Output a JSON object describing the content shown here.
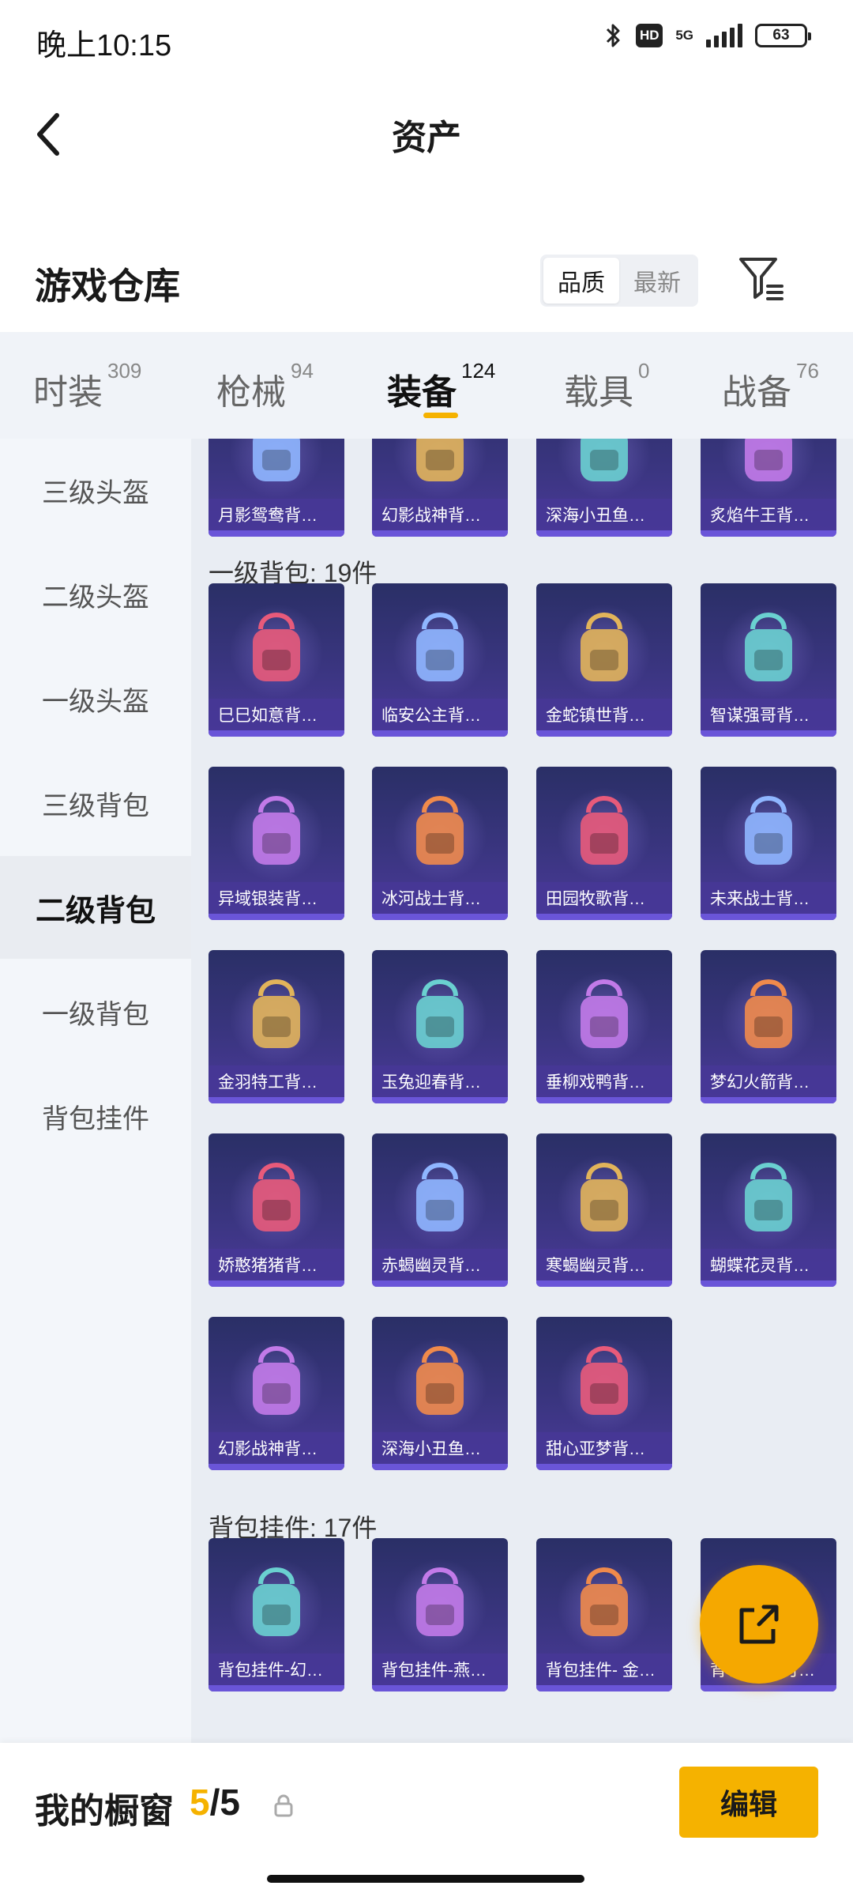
{
  "status": {
    "time": "晚上10:15",
    "hd": "HD",
    "net": "5G",
    "battery": "63"
  },
  "header": {
    "title": "资产"
  },
  "warehouse": {
    "title": "游戏仓库",
    "sort_options": [
      "品质",
      "最新"
    ],
    "sort_selected": "品质"
  },
  "tabs": [
    {
      "label": "时装",
      "count": "309"
    },
    {
      "label": "枪械",
      "count": "94"
    },
    {
      "label": "装备",
      "count": "124"
    },
    {
      "label": "载具",
      "count": "0"
    },
    {
      "label": "战备",
      "count": "76"
    }
  ],
  "active_tab": "装备",
  "sidenav": [
    "三级头盔",
    "二级头盔",
    "一级头盔",
    "三级背包",
    "二级背包",
    "一级背包",
    "背包挂件"
  ],
  "active_side": "二级背包",
  "top_row": [
    "月影鸳鸯背…",
    "幻影战神背…",
    "深海小丑鱼…",
    "炙焰牛王背…"
  ],
  "sections": [
    {
      "title": "一级背包: 19件",
      "items": [
        "巳巳如意背…",
        "临安公主背…",
        "金蛇镇世背…",
        "智谋强哥背…",
        "异域银装背…",
        "冰河战士背…",
        "田园牧歌背…",
        "未来战士背…",
        "金羽特工背…",
        "玉兔迎春背…",
        "垂柳戏鸭背…",
        "梦幻火箭背…",
        "娇憨猪猪背…",
        "赤蝎幽灵背…",
        "寒蝎幽灵背…",
        "蝴蝶花灵背…",
        "幻影战神背…",
        "深海小丑鱼…",
        "甜心亚梦背…"
      ]
    },
    {
      "title": "背包挂件: 17件",
      "items": [
        "背包挂件-幻…",
        "背包挂件-燕…",
        "背包挂件- 金…",
        "背包挂件-月…"
      ]
    }
  ],
  "bottom": {
    "label": "我的橱窗",
    "current": "5",
    "total": "/5",
    "edit": "编辑"
  },
  "colors": {
    "accent": "#f5b200",
    "card_top": "#2a2f66",
    "card_bottom": "#4b3a9a"
  }
}
